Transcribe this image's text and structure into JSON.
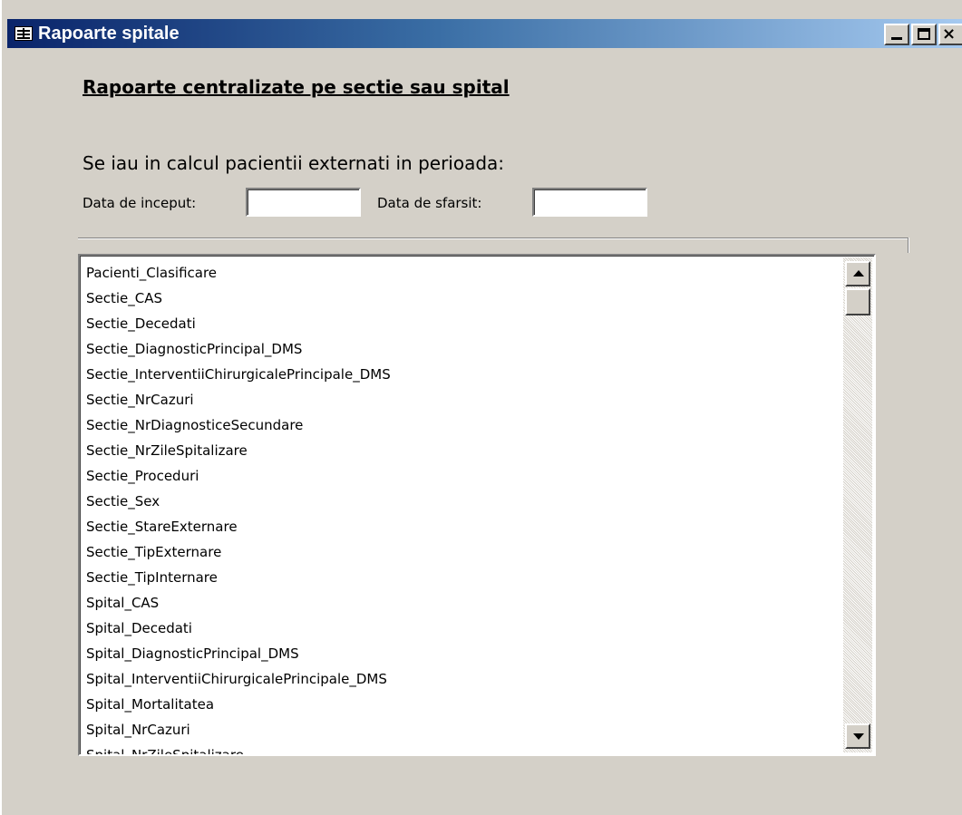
{
  "window": {
    "title": "Rapoarte spitale",
    "close_symbol": "×"
  },
  "form": {
    "heading": "Rapoarte centralizate pe sectie sau spital",
    "subtitle": "Se iau in calcul pacientii externati in perioada:",
    "start_date_label": "Data de inceput:",
    "start_date_value": "",
    "end_date_label": "Data de sfarsit:",
    "end_date_value": ""
  },
  "reports": {
    "items": [
      "Pacienti_Clasificare",
      "Sectie_CAS",
      "Sectie_Decedati",
      "Sectie_DiagnosticPrincipal_DMS",
      "Sectie_InterventiiChirurgicalePrincipale_DMS",
      "Sectie_NrCazuri",
      "Sectie_NrDiagnosticeSecundare",
      "Sectie_NrZileSpitalizare",
      "Sectie_Proceduri",
      "Sectie_Sex",
      "Sectie_StareExternare",
      "Sectie_TipExternare",
      "Sectie_TipInternare",
      "Spital_CAS",
      "Spital_Decedati",
      "Spital_DiagnosticPrincipal_DMS",
      "Spital_InterventiiChirurgicalePrincipale_DMS",
      "Spital_Mortalitatea",
      "Spital_NrCazuri",
      "Spital_NrZileSpitalizare"
    ]
  },
  "icons": {
    "app": "form-icon",
    "minimize": "minimize-icon",
    "maximize": "maximize-icon",
    "close": "close-icon",
    "scroll_up": "scroll-up-arrow-icon",
    "scroll_down": "scroll-down-arrow-icon"
  },
  "colors": {
    "titlebar_start": "#0a246a",
    "titlebar_end": "#a6caf0",
    "window_bg": "#d4d0c8"
  }
}
